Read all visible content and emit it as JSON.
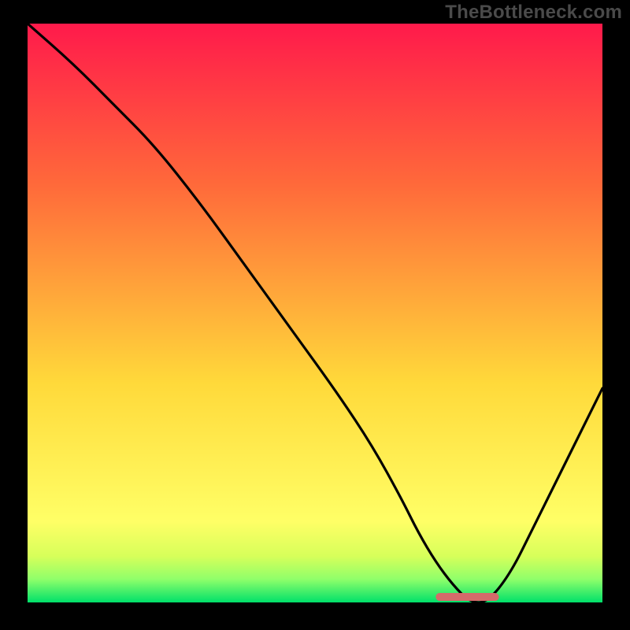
{
  "watermark": "TheBottleneck.com",
  "colors": {
    "background": "#000000",
    "curve": "#000000",
    "marker": "#d46a6a",
    "watermark_text": "#4a4a4a",
    "gradient_top": "#ff1a4b",
    "gradient_mid1": "#ff6a3a",
    "gradient_mid2": "#ffd93a",
    "gradient_band1": "#ffff66",
    "gradient_band2": "#d7ff5a",
    "gradient_band3": "#8fff6a",
    "gradient_bottom": "#00e06a"
  },
  "chart_data": {
    "type": "line",
    "title": "",
    "xlabel": "",
    "ylabel": "",
    "xlim": [
      0,
      100
    ],
    "ylim": [
      0,
      100
    ],
    "grid": false,
    "legend": false,
    "series": [
      {
        "name": "curve",
        "x": [
          0,
          8,
          15,
          22,
          30,
          38,
          46,
          54,
          60,
          65,
          68,
          71,
          74,
          77,
          80,
          84,
          88,
          92,
          96,
          100
        ],
        "y": [
          100,
          93,
          86,
          79,
          69,
          58,
          47,
          36,
          27,
          18,
          12,
          7,
          3,
          0,
          0,
          5,
          13,
          21,
          29,
          37
        ]
      }
    ],
    "minimum_band_x": [
      71,
      82
    ],
    "annotations": []
  }
}
